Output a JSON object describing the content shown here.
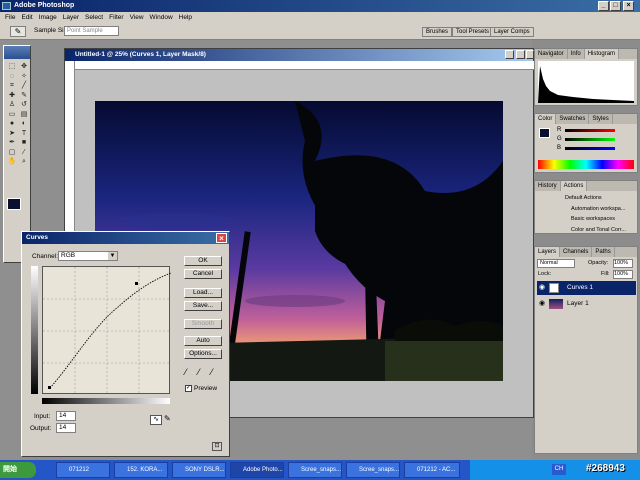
{
  "app": {
    "title": "Adobe Photoshop"
  },
  "menu": [
    "File",
    "Edit",
    "Image",
    "Layer",
    "Select",
    "Filter",
    "View",
    "Window",
    "Help"
  ],
  "options": {
    "sample_label": "Sample Size:",
    "sample_value": "Point Sample",
    "palette_tabs": [
      "Brushes",
      "Tool Presets",
      "Layer Comps"
    ]
  },
  "document": {
    "title": "Untitled-1 @ 25% (Curves 1, Layer Mask/8)"
  },
  "curves": {
    "title": "Curves",
    "channel_label": "Channel:",
    "channel_value": "RGB",
    "buttons": {
      "ok": "OK",
      "cancel": "Cancel",
      "load": "Load...",
      "save": "Save...",
      "smooth": "Smooth",
      "auto": "Auto",
      "options": "Options..."
    },
    "preview_label": "Preview",
    "preview_checked": true,
    "input_label": "Input:",
    "input_value": "14",
    "output_label": "Output:",
    "output_value": "14"
  },
  "panels": {
    "navigator_tabs": [
      "Navigator",
      "Info",
      "Histogram"
    ],
    "color_tabs": [
      "Color",
      "Swatches",
      "Styles"
    ],
    "rgb_labels": [
      "R",
      "G",
      "B"
    ],
    "actions_tabs": [
      "History",
      "Actions"
    ],
    "actions": [
      "Default Actions",
      "Automation workspa...",
      "Basic workspaces",
      "Color and Tonal Corr..."
    ],
    "layers_tabs": [
      "Layers",
      "Channels",
      "Paths"
    ],
    "blend_mode": "Normal",
    "opacity_label": "Opacity:",
    "opacity_value": "100%",
    "lock_label": "Lock:",
    "fill_label": "Fill:",
    "fill_value": "100%",
    "layers": [
      "Curves 1",
      "Layer 1"
    ]
  },
  "taskbar": {
    "start": "開始",
    "tasks": [
      "071212",
      "152. KORA...",
      "SONY DSLR...",
      "Adobe Photo...",
      "Scree_snaps...",
      "Scree_snaps...",
      "071212 - AC..."
    ],
    "tray_label": "CH"
  },
  "watermark": "#268943",
  "colors": {
    "titlebar": "#0a246a",
    "taskbar": "#2456c8",
    "dialog": "#d4d0c8"
  }
}
